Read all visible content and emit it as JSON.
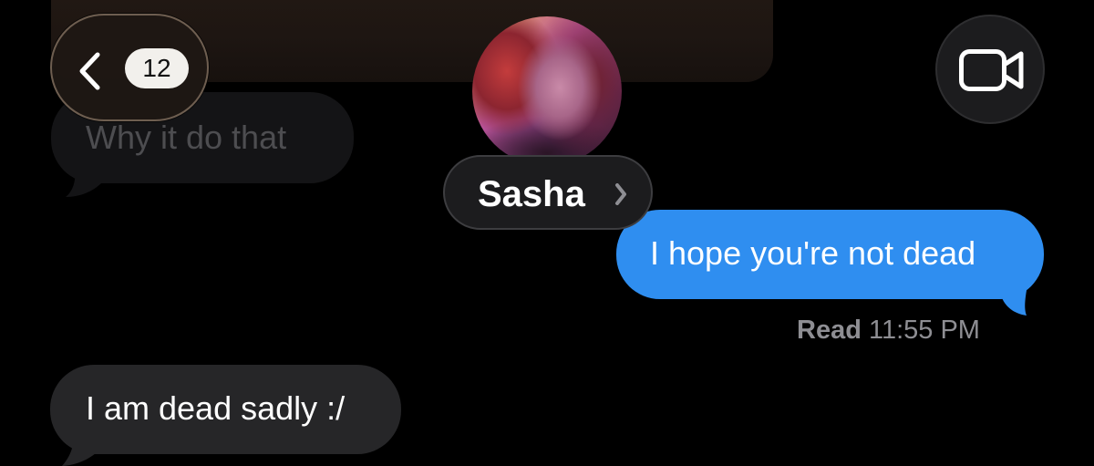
{
  "header": {
    "back_badge_count": "12",
    "contact_name": "Sasha"
  },
  "messages": [
    {
      "direction": "incoming",
      "text": "Why it do that",
      "faded": true
    },
    {
      "direction": "outgoing",
      "text": "I hope you're not dead"
    },
    {
      "direction": "incoming",
      "text": "I am dead sadly :/"
    }
  ],
  "read_receipt": {
    "label": "Read",
    "time": "11:55 PM"
  },
  "colors": {
    "background": "#000000",
    "outgoing_bubble": "#2f8ef0",
    "incoming_bubble": "#262628",
    "secondary_text": "#8e8e93"
  },
  "icons": [
    "chevron-left-icon",
    "video-camera-icon",
    "chevron-right-icon"
  ]
}
